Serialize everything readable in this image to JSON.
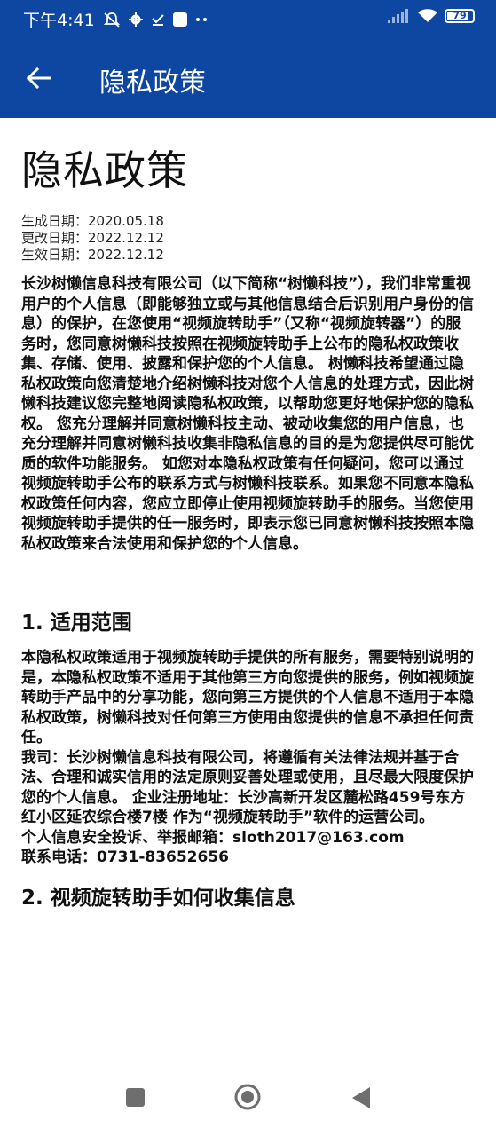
{
  "status_bar": {
    "time": "下午4:41",
    "battery": "79",
    "icons": [
      "mute-icon",
      "gear-icon",
      "download-done-icon",
      "square-icon",
      "more-dots-icon",
      "signal-icon",
      "wifi-icon",
      "battery-icon"
    ]
  },
  "app_bar": {
    "title": "隐私政策",
    "background": "#0d47a1"
  },
  "document": {
    "title": "隐私政策",
    "dates": {
      "generated": "生成日期：2020.05.18",
      "updated": "更改日期：2022.12.12",
      "effective": "生效日期：2022.12.12"
    },
    "intro": "长沙树懒信息科技有限公司（以下简称“树懒科技”），我们非常重视用户的个人信息（即能够独立或与其他信息结合后识别用户身份的信息）的保护，在您使用“视频旋转助手”（又称“视频旋转器”）的服务时，您同意树懒科技按照在视频旋转助手上公布的隐私权政策收集、存储、使用、披露和保护您的个人信息。 树懒科技希望通过隐私权政策向您清楚地介绍树懒科技对您个人信息的处理方式，因此树懒科技建议您完整地阅读隐私权政策，以帮助您更好地保护您的隐私权。 您充分理解并同意树懒科技主动、被动收集您的用户信息，也充分理解并同意树懒科技收集非隐私信息的目的是为您提供尽可能优质的软件功能服务。 如您对本隐私权政策有任何疑问，您可以通过视频旋转助手公布的联系方式与树懒科技联系。如果您不同意本隐私权政策任何内容，您应立即停止使用视频旋转助手的服务。当您使用视频旋转助手提供的任一服务时，即表示您已同意树懒科技按照本隐私权政策来合法使用和保护您的个人信息。",
    "section1": {
      "heading": "1. 适用范围",
      "para1": "本隐私权政策适用于视频旋转助手提供的所有服务，需要特别说明的是，本隐私权政策不适用于其他第三方向您提供的服务，例如视频旋转助手产品中的分享功能，您向第三方提供的个人信息不适用于本隐私权政策，树懒科技对任何第三方使用由您提供的信息不承担任何责任。",
      "para2": "我司：长沙树懒信息科技有限公司，将遵循有关法律法规并基于合法、合理和诚实信用的法定原则妥善处理或使用，且尽最大限度保护您的个人信息。 企业注册地址：长沙高新开发区麓松路459号东方红小区延农综合楼7楼 作为“视频旋转助手”软件的运营公司。",
      "email_line": "个人信息安全投诉、举报邮箱：sloth2017@163.com",
      "phone_line": "联系电话：0731-83652656"
    },
    "section2": {
      "heading": "2. 视频旋转助手如何收集信息"
    }
  }
}
